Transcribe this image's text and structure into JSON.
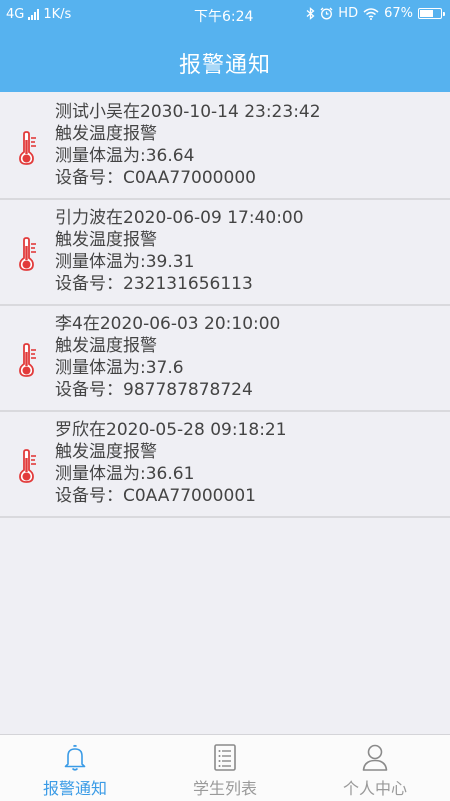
{
  "status_bar": {
    "network": "4G",
    "speed": "1K/s",
    "time": "下午6:24",
    "hd": "HD",
    "battery": "67%",
    "battery_level": 0.67
  },
  "header": {
    "title": "报警通知"
  },
  "alerts": [
    {
      "title": "测试小吴在2030-10-14 23:23:42",
      "type": "触发温度报警",
      "temperature": "测量体温为:36.64",
      "device": "设备号：C0AA77000000"
    },
    {
      "title": "引力波在2020-06-09 17:40:00",
      "type": "触发温度报警",
      "temperature": "测量体温为:39.31",
      "device": "设备号：232131656113"
    },
    {
      "title": "李4在2020-06-03 20:10:00",
      "type": "触发温度报警",
      "temperature": "测量体温为:37.6",
      "device": "设备号：987787878724"
    },
    {
      "title": "罗欣在2020-05-28 09:18:21",
      "type": "触发温度报警",
      "temperature": "测量体温为:36.61",
      "device": "设备号：C0AA77000001"
    }
  ],
  "tabs": [
    {
      "label": "报警通知",
      "icon": "bell-icon",
      "active": true
    },
    {
      "label": "学生列表",
      "icon": "list-icon",
      "active": false
    },
    {
      "label": "个人中心",
      "icon": "person-icon",
      "active": false
    }
  ],
  "colors": {
    "primary": "#56b2ef",
    "active_tab": "#3a9be6",
    "thermometer": "#e23b3b",
    "background": "#efeff4"
  }
}
